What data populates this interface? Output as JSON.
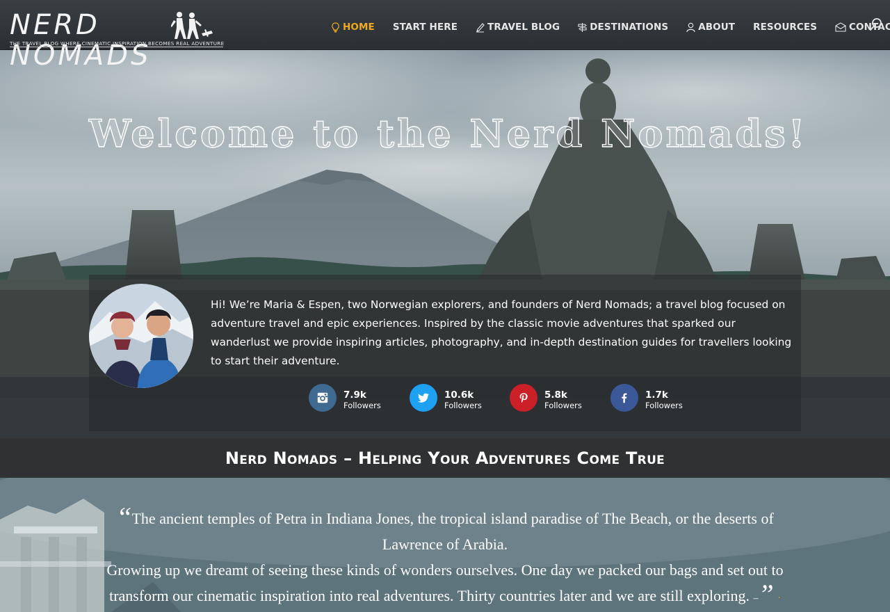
{
  "header": {
    "logo_title": "NERD NOMADS",
    "logo_tagline": "THE TRAVEL BLOG WHERE CINEMATIC INSPIRATION BECOMES REAL ADVENTURE",
    "nav": [
      {
        "label": "HOME",
        "icon": "lightbulb-icon",
        "active": true
      },
      {
        "label": "START HERE",
        "icon": "",
        "active": false
      },
      {
        "label": "TRAVEL BLOG",
        "icon": "pencil-icon",
        "active": false
      },
      {
        "label": "DESTINATIONS",
        "icon": "signpost-icon",
        "active": false
      },
      {
        "label": "ABOUT",
        "icon": "person-icon",
        "active": false
      },
      {
        "label": "RESOURCES",
        "icon": "",
        "active": false
      },
      {
        "label": "CONTACT",
        "icon": "envelope-icon",
        "active": false
      }
    ],
    "search_icon": "search-icon",
    "active_color": "#f0a91e"
  },
  "hero": {
    "title": "Welcome to the Nerd Nomads!",
    "intro": "Hi! We’re Maria & Espen, two Norwegian explorers, and founders of Nerd Nomads; a travel blog focused on adventure travel and epic experiences. Inspired by the classic movie adventures that sparked our wanderlust we provide inspiring articles, photography, and in-depth destination guides for travellers looking to start their adventure.",
    "social": [
      {
        "network": "instagram",
        "icon": "instagram-icon",
        "count": "7.9k",
        "label": "Followers",
        "color": "#3f6b92"
      },
      {
        "network": "twitter",
        "icon": "twitter-icon",
        "count": "10.6k",
        "label": "Followers",
        "color": "#1ea1f2"
      },
      {
        "network": "pinterest",
        "icon": "pinterest-icon",
        "count": "5.8k",
        "label": "Followers",
        "color": "#cb2027"
      },
      {
        "network": "facebook",
        "icon": "facebook-icon",
        "count": "1.7k",
        "label": "Followers",
        "color": "#3b5998"
      }
    ]
  },
  "tagline": "Nerd Nomads – Helping Your Adventures Come True",
  "quote": {
    "open_mark": "“",
    "line1": "The ancient temples of Petra in Indiana Jones, the tropical island paradise of The Beach, or the deserts of Lawrence of Arabia.",
    "line2": "Growing up we dreamt of seeing these kinds of wonders ourselves. One day we packed our bags and set out to transform our cinematic inspiration into real adventures. Thirty countries later and we are still exploring.",
    "dash": "–",
    "close_mark": "”"
  }
}
